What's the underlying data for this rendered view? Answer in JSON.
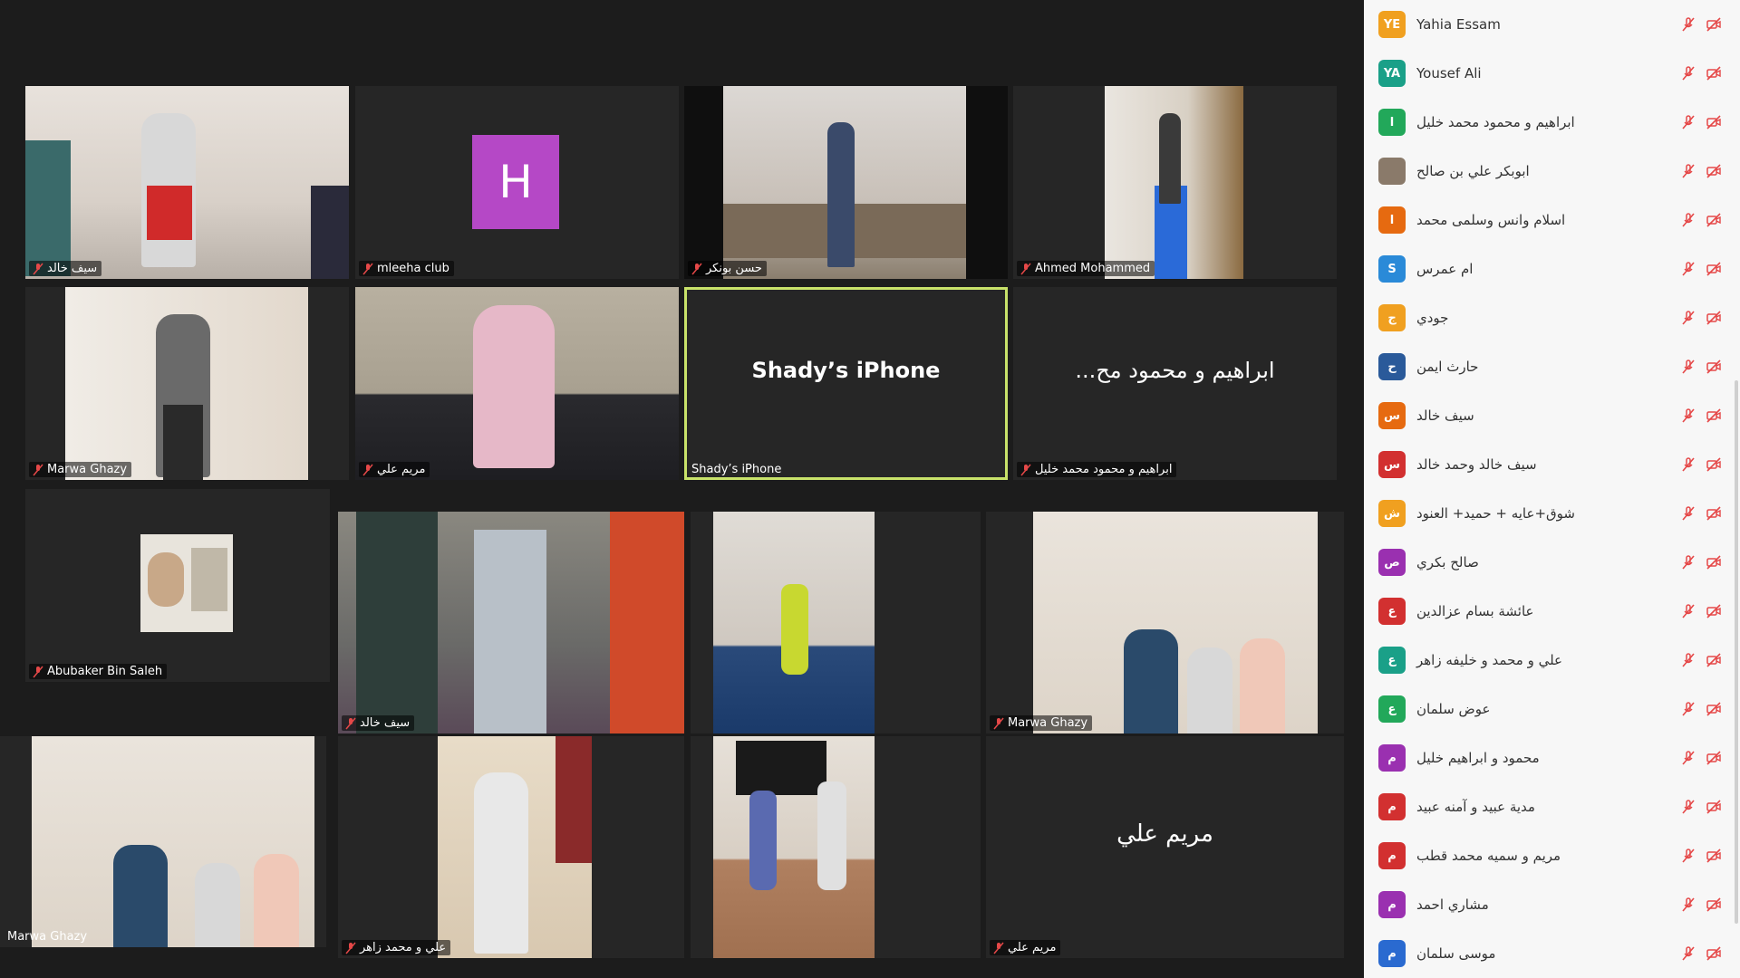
{
  "gallery": {
    "tiles": [
      {
        "name": "سيف خالد"
      },
      {
        "name": "mleeha club",
        "avatar_letter": "H"
      },
      {
        "name": "حسن بونكر"
      },
      {
        "name": "Ahmed Mohammed"
      },
      {
        "name": "Marwa Ghazy"
      },
      {
        "name": "مريم علي"
      },
      {
        "name": "Shady’s iPhone",
        "center_text": "Shady’s iPhone"
      },
      {
        "name": "ابراهيم و محمود محمد خليل",
        "center_text": "...ابراهيم و محمود مح"
      },
      {
        "name": "Abubaker Bin Saleh"
      },
      {
        "name": "سيف خالد"
      },
      {
        "name": ""
      },
      {
        "name": "Marwa Ghazy"
      },
      {
        "name": "Marwa Ghazy"
      },
      {
        "name": "علي و محمد زاهر"
      },
      {
        "name": ""
      },
      {
        "name": "مريم علي",
        "center_text": "مريم علي"
      }
    ]
  },
  "participants": [
    {
      "initials": "YE",
      "color": "#f0a020",
      "name": "Yahia Essam"
    },
    {
      "initials": "YA",
      "color": "#1aa088",
      "name": "Yousef Ali"
    },
    {
      "initials": "ا",
      "color": "#22a85a",
      "name": "ابراهيم و محمود محمد خليل"
    },
    {
      "initials": "",
      "color": "#8a7a6a",
      "name": "ابوبكر علي بن صالح"
    },
    {
      "initials": "ا",
      "color": "#e66a10",
      "name": "اسلام وانس وسلمى محمد"
    },
    {
      "initials": "S",
      "color": "#2a8ad8",
      "name": "ام عمرس"
    },
    {
      "initials": "ج",
      "color": "#f0a020",
      "name": "جودي"
    },
    {
      "initials": "ح",
      "color": "#2a5a9a",
      "name": "حارث ايمن"
    },
    {
      "initials": "س",
      "color": "#e66a10",
      "name": "سيف خالد"
    },
    {
      "initials": "س",
      "color": "#d23030",
      "name": "سيف خالد وحمد خالد"
    },
    {
      "initials": "ش",
      "color": "#f0a020",
      "name": "شوق+عايه + حميد+ العنود"
    },
    {
      "initials": "ص",
      "color": "#9a30b0",
      "name": "صالح بكري"
    },
    {
      "initials": "ع",
      "color": "#d23030",
      "name": "عائشة بسام عزالدين"
    },
    {
      "initials": "ع",
      "color": "#1aa088",
      "name": "علي و محمد و خليفه زاهر"
    },
    {
      "initials": "ع",
      "color": "#22a85a",
      "name": "عوض سلمان"
    },
    {
      "initials": "م",
      "color": "#9a30b0",
      "name": "محمود و ابراهيم خليل"
    },
    {
      "initials": "م",
      "color": "#d23030",
      "name": "مدية عبيد و آمنه عبيد"
    },
    {
      "initials": "م",
      "color": "#d23030",
      "name": "مريم و سميه محمد قطب"
    },
    {
      "initials": "م",
      "color": "#9a30b0",
      "name": "مشاري احمد"
    },
    {
      "initials": "م",
      "color": "#2a6ad0",
      "name": "موسى سلمان"
    }
  ]
}
